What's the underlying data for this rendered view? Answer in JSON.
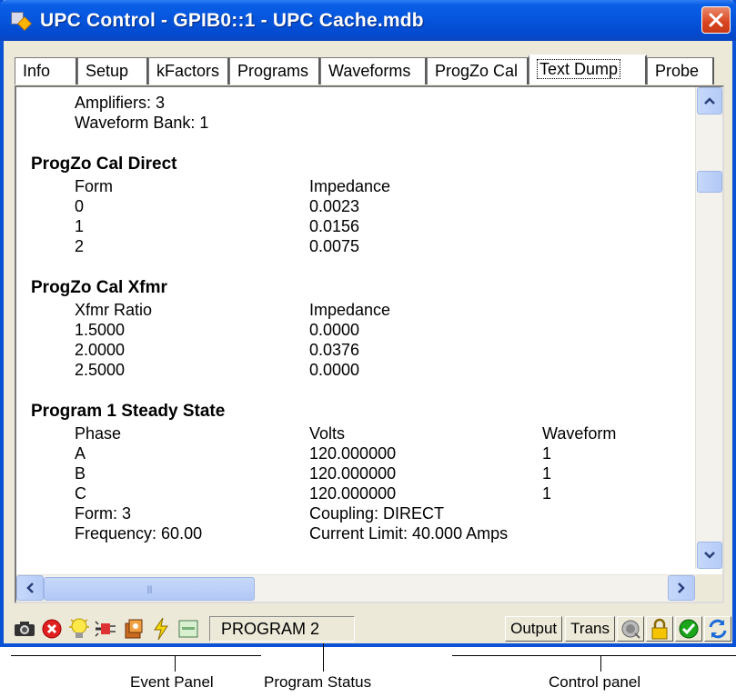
{
  "window": {
    "title": "UPC Control - GPIB0::1 - UPC Cache.mdb"
  },
  "tabs": [
    {
      "label": "Info",
      "active": false
    },
    {
      "label": "Setup",
      "active": false
    },
    {
      "label": "kFactors",
      "active": false
    },
    {
      "label": "Programs",
      "active": false
    },
    {
      "label": "Waveforms",
      "active": false
    },
    {
      "label": "ProgZo Cal",
      "active": false
    },
    {
      "label": "Text Dump",
      "active": true
    },
    {
      "label": "Probe",
      "active": false
    }
  ],
  "dump": {
    "amplifiers": "Amplifiers: 3",
    "waveform_bank": "Waveform Bank: 1",
    "direct": {
      "title": "ProgZo Cal Direct",
      "col1": "Form",
      "col2": "Impedance",
      "rows": [
        [
          "0",
          "0.0023"
        ],
        [
          "1",
          "0.0156"
        ],
        [
          "2",
          "0.0075"
        ]
      ]
    },
    "xfmr": {
      "title": "ProgZo Cal Xfmr",
      "col1": "Xfmr Ratio",
      "col2": "Impedance",
      "rows": [
        [
          "1.5000",
          "0.0000"
        ],
        [
          "2.0000",
          "0.0376"
        ],
        [
          "2.5000",
          "0.0000"
        ]
      ]
    },
    "program1": {
      "title": "Program 1 Steady State",
      "col1": "Phase",
      "col2": "Volts",
      "col3": "Waveform",
      "rows": [
        [
          "A",
          "120.000000",
          "1"
        ],
        [
          "B",
          "120.000000",
          "1"
        ],
        [
          "C",
          "120.000000",
          "1"
        ]
      ],
      "form": "Form: 3",
      "coupling": "Coupling: DIRECT",
      "frequency": "Frequency: 60.00",
      "current_limit": "Current Limit: 40.000 Amps"
    }
  },
  "status": {
    "program_status": "PROGRAM 2",
    "output_label": "Output",
    "trans_label": "Trans"
  },
  "annotations": {
    "event_panel": "Event Panel",
    "program_status": "Program  Status",
    "control_panel": "Control panel"
  },
  "colors": {
    "titlebar": "#0556dd",
    "frame": "#0a52d6",
    "close": "#d9441f",
    "scroll": "#c6d8fb"
  }
}
